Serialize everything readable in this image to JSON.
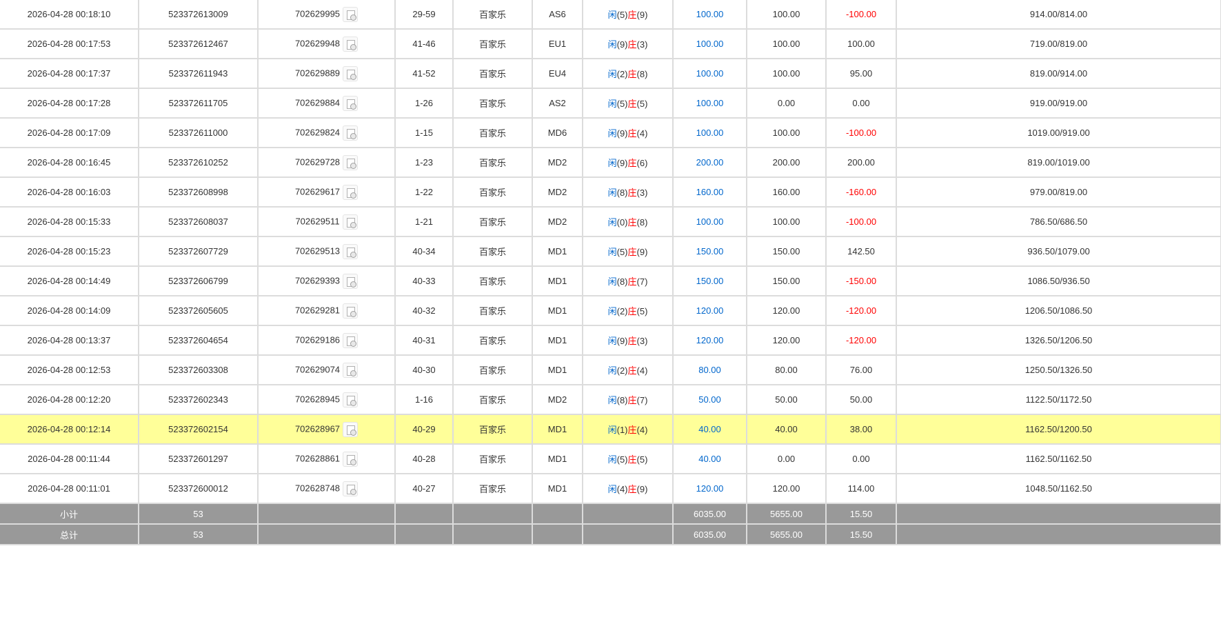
{
  "rows": [
    {
      "time": "2026-04-28 00:18:10",
      "order_no": "523372613009",
      "round_no": "702629995",
      "shoe": "29-59",
      "game": "百家乐",
      "table": "AS6",
      "player_label": "闲",
      "player": "(5)",
      "banker_label": "庄",
      "banker": "(9)",
      "bet": "100.00",
      "valid": "100.00",
      "winloss": "-100.00",
      "balance": "914.00/814.00",
      "highlight": false
    },
    {
      "time": "2026-04-28 00:17:53",
      "order_no": "523372612467",
      "round_no": "702629948",
      "shoe": "41-46",
      "game": "百家乐",
      "table": "EU1",
      "player_label": "闲",
      "player": "(9)",
      "banker_label": "庄",
      "banker": "(3)",
      "bet": "100.00",
      "valid": "100.00",
      "winloss": "100.00",
      "balance": "719.00/819.00",
      "highlight": false
    },
    {
      "time": "2026-04-28 00:17:37",
      "order_no": "523372611943",
      "round_no": "702629889",
      "shoe": "41-52",
      "game": "百家乐",
      "table": "EU4",
      "player_label": "闲",
      "player": "(2)",
      "banker_label": "庄",
      "banker": "(8)",
      "bet": "100.00",
      "valid": "100.00",
      "winloss": "95.00",
      "balance": "819.00/914.00",
      "highlight": false
    },
    {
      "time": "2026-04-28 00:17:28",
      "order_no": "523372611705",
      "round_no": "702629884",
      "shoe": "1-26",
      "game": "百家乐",
      "table": "AS2",
      "player_label": "闲",
      "player": "(5)",
      "banker_label": "庄",
      "banker": "(5)",
      "bet": "100.00",
      "valid": "0.00",
      "winloss": "0.00",
      "balance": "919.00/919.00",
      "highlight": false
    },
    {
      "time": "2026-04-28 00:17:09",
      "order_no": "523372611000",
      "round_no": "702629824",
      "shoe": "1-15",
      "game": "百家乐",
      "table": "MD6",
      "player_label": "闲",
      "player": "(9)",
      "banker_label": "庄",
      "banker": "(4)",
      "bet": "100.00",
      "valid": "100.00",
      "winloss": "-100.00",
      "balance": "1019.00/919.00",
      "highlight": false
    },
    {
      "time": "2026-04-28 00:16:45",
      "order_no": "523372610252",
      "round_no": "702629728",
      "shoe": "1-23",
      "game": "百家乐",
      "table": "MD2",
      "player_label": "闲",
      "player": "(9)",
      "banker_label": "庄",
      "banker": "(6)",
      "bet": "200.00",
      "valid": "200.00",
      "winloss": "200.00",
      "balance": "819.00/1019.00",
      "highlight": false
    },
    {
      "time": "2026-04-28 00:16:03",
      "order_no": "523372608998",
      "round_no": "702629617",
      "shoe": "1-22",
      "game": "百家乐",
      "table": "MD2",
      "player_label": "闲",
      "player": "(8)",
      "banker_label": "庄",
      "banker": "(3)",
      "bet": "160.00",
      "valid": "160.00",
      "winloss": "-160.00",
      "balance": "979.00/819.00",
      "highlight": false
    },
    {
      "time": "2026-04-28 00:15:33",
      "order_no": "523372608037",
      "round_no": "702629511",
      "shoe": "1-21",
      "game": "百家乐",
      "table": "MD2",
      "player_label": "闲",
      "player": "(0)",
      "banker_label": "庄",
      "banker": "(8)",
      "bet": "100.00",
      "valid": "100.00",
      "winloss": "-100.00",
      "balance": "786.50/686.50",
      "highlight": false
    },
    {
      "time": "2026-04-28 00:15:23",
      "order_no": "523372607729",
      "round_no": "702629513",
      "shoe": "40-34",
      "game": "百家乐",
      "table": "MD1",
      "player_label": "闲",
      "player": "(5)",
      "banker_label": "庄",
      "banker": "(9)",
      "bet": "150.00",
      "valid": "150.00",
      "winloss": "142.50",
      "balance": "936.50/1079.00",
      "highlight": false
    },
    {
      "time": "2026-04-28 00:14:49",
      "order_no": "523372606799",
      "round_no": "702629393",
      "shoe": "40-33",
      "game": "百家乐",
      "table": "MD1",
      "player_label": "闲",
      "player": "(8)",
      "banker_label": "庄",
      "banker": "(7)",
      "bet": "150.00",
      "valid": "150.00",
      "winloss": "-150.00",
      "balance": "1086.50/936.50",
      "highlight": false
    },
    {
      "time": "2026-04-28 00:14:09",
      "order_no": "523372605605",
      "round_no": "702629281",
      "shoe": "40-32",
      "game": "百家乐",
      "table": "MD1",
      "player_label": "闲",
      "player": "(2)",
      "banker_label": "庄",
      "banker": "(5)",
      "bet": "120.00",
      "valid": "120.00",
      "winloss": "-120.00",
      "balance": "1206.50/1086.50",
      "highlight": false
    },
    {
      "time": "2026-04-28 00:13:37",
      "order_no": "523372604654",
      "round_no": "702629186",
      "shoe": "40-31",
      "game": "百家乐",
      "table": "MD1",
      "player_label": "闲",
      "player": "(9)",
      "banker_label": "庄",
      "banker": "(3)",
      "bet": "120.00",
      "valid": "120.00",
      "winloss": "-120.00",
      "balance": "1326.50/1206.50",
      "highlight": false
    },
    {
      "time": "2026-04-28 00:12:53",
      "order_no": "523372603308",
      "round_no": "702629074",
      "shoe": "40-30",
      "game": "百家乐",
      "table": "MD1",
      "player_label": "闲",
      "player": "(2)",
      "banker_label": "庄",
      "banker": "(4)",
      "bet": "80.00",
      "valid": "80.00",
      "winloss": "76.00",
      "balance": "1250.50/1326.50",
      "highlight": false
    },
    {
      "time": "2026-04-28 00:12:20",
      "order_no": "523372602343",
      "round_no": "702628945",
      "shoe": "1-16",
      "game": "百家乐",
      "table": "MD2",
      "player_label": "闲",
      "player": "(8)",
      "banker_label": "庄",
      "banker": "(7)",
      "bet": "50.00",
      "valid": "50.00",
      "winloss": "50.00",
      "balance": "1122.50/1172.50",
      "highlight": false
    },
    {
      "time": "2026-04-28 00:12:14",
      "order_no": "523372602154",
      "round_no": "702628967",
      "shoe": "40-29",
      "game": "百家乐",
      "table": "MD1",
      "player_label": "闲",
      "player": "(1)",
      "banker_label": "庄",
      "banker": "(4)",
      "bet": "40.00",
      "valid": "40.00",
      "winloss": "38.00",
      "balance": "1162.50/1200.50",
      "highlight": true
    },
    {
      "time": "2026-04-28 00:11:44",
      "order_no": "523372601297",
      "round_no": "702628861",
      "shoe": "40-28",
      "game": "百家乐",
      "table": "MD1",
      "player_label": "闲",
      "player": "(5)",
      "banker_label": "庄",
      "banker": "(5)",
      "bet": "40.00",
      "valid": "0.00",
      "winloss": "0.00",
      "balance": "1162.50/1162.50",
      "highlight": false
    },
    {
      "time": "2026-04-28 00:11:01",
      "order_no": "523372600012",
      "round_no": "702628748",
      "shoe": "40-27",
      "game": "百家乐",
      "table": "MD1",
      "player_label": "闲",
      "player": "(4)",
      "banker_label": "庄",
      "banker": "(9)",
      "bet": "120.00",
      "valid": "120.00",
      "winloss": "114.00",
      "balance": "1048.50/1162.50",
      "highlight": false
    }
  ],
  "subtotal": {
    "label": "小计",
    "count": "53",
    "bet": "6035.00",
    "valid": "5655.00",
    "winloss": "15.50"
  },
  "total": {
    "label": "总计",
    "count": "53",
    "bet": "6035.00",
    "valid": "5655.00",
    "winloss": "15.50"
  },
  "colors": {
    "blue": "#0066cc",
    "red": "#ff0000",
    "highlight": "#ffff99",
    "summary_bg": "#999999"
  },
  "icons": {
    "detail": "document-icon"
  }
}
